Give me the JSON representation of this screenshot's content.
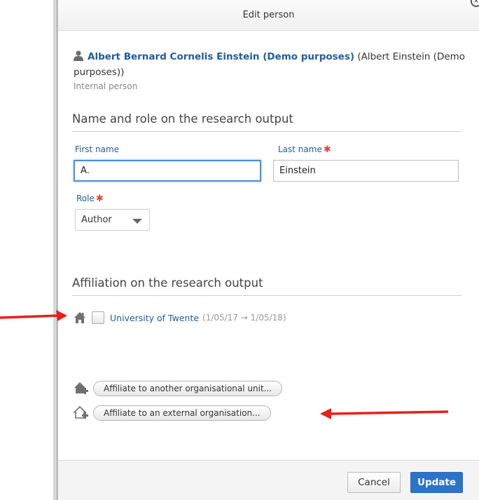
{
  "dialog": {
    "title": "Edit person",
    "close_glyph": "×"
  },
  "person": {
    "icon": "person-icon",
    "full_name": "Albert Bernard Cornelis Einstein (Demo purposes)",
    "alias": "(Albert Einstein (Demo purposes))",
    "type": "Internal person"
  },
  "name_role": {
    "section_title": "Name and role on the research output",
    "first_name_label": "First name",
    "first_name_value": "A.",
    "last_name_label": "Last name",
    "last_name_value": "Einstein",
    "required_mark": "✱",
    "role_label": "Role",
    "role_value": "Author"
  },
  "affiliation": {
    "section_title": "Affiliation on the research output",
    "items": [
      {
        "icon": "house-icon",
        "name": "University of Twente",
        "dates": "(1/05/17 → 1/05/18)"
      }
    ],
    "actions": [
      {
        "icon": "add-house-icon",
        "label": "Affiliate to another organisational unit..."
      },
      {
        "icon": "add-external-house-icon",
        "label": "Affiliate to an external organisation..."
      }
    ]
  },
  "footer": {
    "cancel_label": "Cancel",
    "update_label": "Update"
  },
  "colors": {
    "link_blue": "#1f5d9e",
    "primary_button": "#2c74c9",
    "required_red": "#e0433e",
    "annotation_arrow": "#e8201b"
  }
}
